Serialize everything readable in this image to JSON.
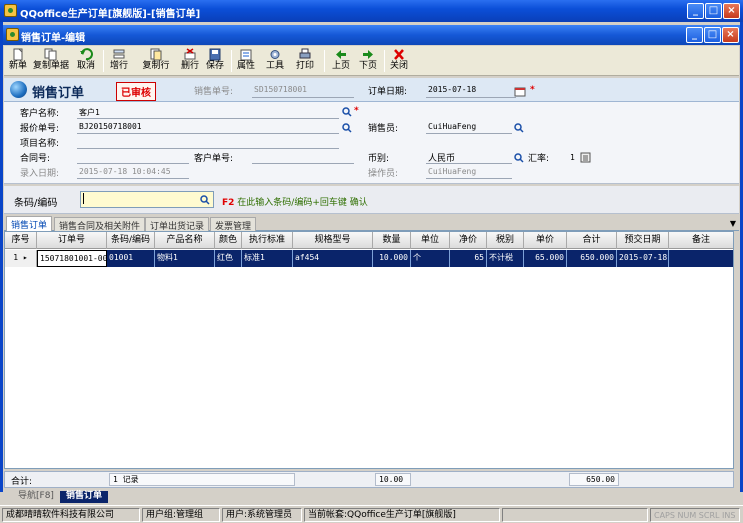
{
  "window": {
    "title": "QQoffice生产订单[旗舰版]-[销售订单]",
    "inner_title": "销售订单-编辑"
  },
  "toolbar": {
    "new": "新单",
    "copy_order": "复制单据",
    "cancel": "取消",
    "add_row": "增行",
    "copy_row": "复制行",
    "delete_row": "删行",
    "save": "保存",
    "properties": "属性",
    "tools": "工具",
    "print": "打印",
    "prev": "上页",
    "next": "下页",
    "close": "关闭"
  },
  "header": {
    "title": "销售订单",
    "status": "已审核",
    "order_no_label": "销售单号:",
    "order_no": "SD150718001",
    "date_label": "订单日期:",
    "date": "2015-07-18"
  },
  "form": {
    "customer_label": "客户名称:",
    "customer": "客户1",
    "quote_label": "报价单号:",
    "quote": "BJ20150718001",
    "salesperson_label": "销售员:",
    "salesperson": "CuiHuaFeng",
    "project_label": "项目名称:",
    "contract_label": "合同号:",
    "customer_no_label": "客户单号:",
    "currency_label": "币别:",
    "currency": "人民币",
    "rate_label": "汇率:",
    "rate": "1",
    "entry_date_label": "录入日期:",
    "entry_date": "2015-07-18 10:04:45",
    "operator_label": "操作员:",
    "operator": "CuiHuaFeng"
  },
  "barcode": {
    "label": "条码/编码",
    "hint_key": "F2",
    "hint": "在此输入条码/编码+回车键 确认"
  },
  "tabs": [
    "销售订单",
    "销售合同及相关附件",
    "订单出货记录",
    "发票管理"
  ],
  "grid": {
    "columns": [
      "序号",
      "订单号",
      "条码/编码",
      "产品名称",
      "颜色",
      "执行标准",
      "规格型号",
      "数量",
      "单位",
      "净价",
      "税别",
      "单价",
      "合计",
      "预交日期",
      "备注"
    ],
    "rows": [
      [
        "1",
        "15071801001-00",
        "01001",
        "物料1",
        "红色",
        "标准1",
        "af454",
        "10.000",
        "个",
        "65",
        "不计税",
        "65.000",
        "650.000",
        "2015-07-18",
        ""
      ]
    ]
  },
  "totals": {
    "label": "合计:",
    "records": "1 记录",
    "qty": "10.00",
    "amount": "650.00"
  },
  "nav": {
    "guide": "导航[F8]",
    "current": "销售订单"
  },
  "status_bar": {
    "company": "成都晴晴软件科技有限公司",
    "user_group": "用户组:管理组",
    "user": "用户:系统管理员",
    "account": "当前帐套:QQoffice生产订单[旗舰版]",
    "keys": "CAPS NUM SCRL INS"
  }
}
